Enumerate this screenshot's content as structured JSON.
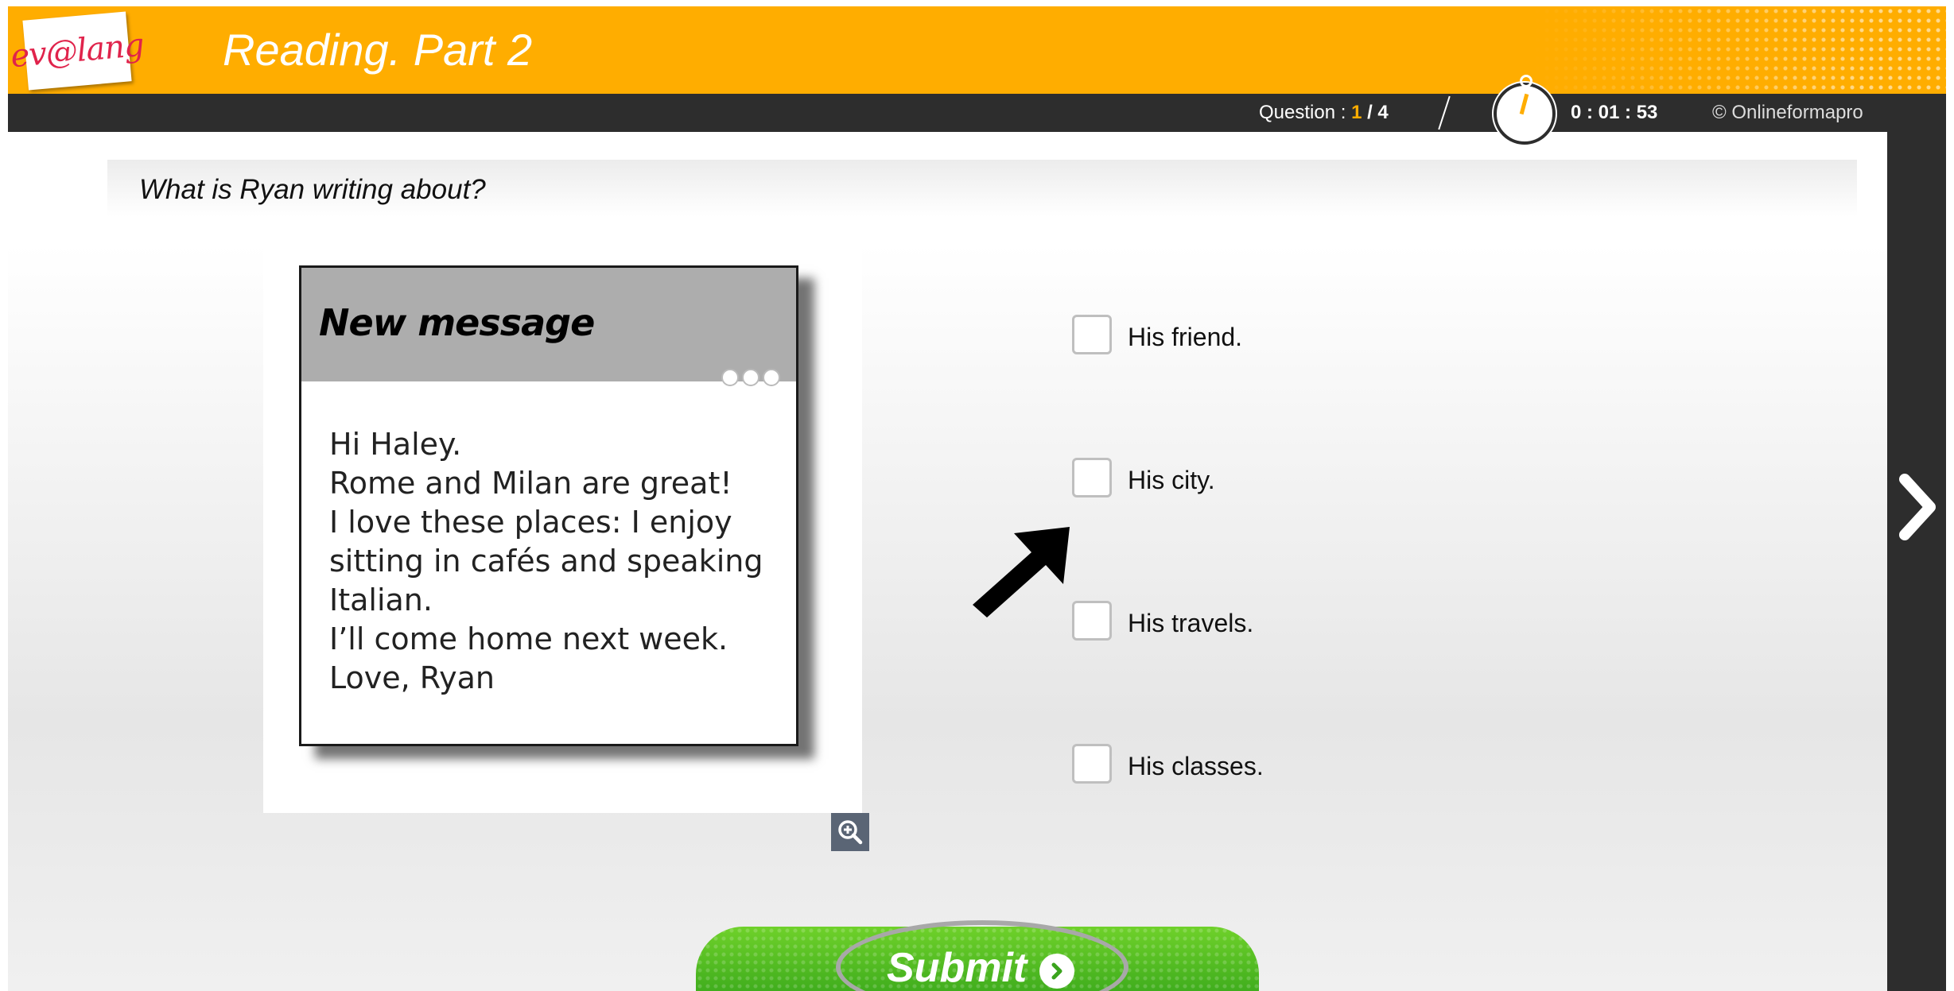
{
  "header": {
    "logo_text": "ev@lang",
    "title": "Reading. Part 2"
  },
  "status": {
    "question_label": "Question : ",
    "question_current": "1",
    "question_total": " / 4",
    "timer": "0 : 01 : 53",
    "copyright": "© Onlineformapro"
  },
  "question": {
    "text": "What is Ryan writing about?"
  },
  "message": {
    "title": "New message",
    "lines": [
      "Hi Haley.",
      "Rome and Milan are great!",
      "I love these places: I enjoy",
      "sitting in cafés and speaking",
      "Italian.",
      "I’ll come home next week.",
      "Love, Ryan"
    ]
  },
  "answers": [
    {
      "label": "His friend.",
      "checked": false
    },
    {
      "label": "His city.",
      "checked": false
    },
    {
      "label": "His travels.",
      "checked": false
    },
    {
      "label": "His classes.",
      "checked": false
    }
  ],
  "submit": {
    "label": "Submit"
  },
  "icons": {
    "timer": "stopwatch-icon",
    "zoom": "zoom-in-icon",
    "next": "chevron-right-icon",
    "pointer": "arrow-pointer-icon",
    "submit": "circle-chevron-right-icon"
  },
  "colors": {
    "header": "#ffad00",
    "statusbar": "#2d2d2d",
    "question_current": "#ffad00",
    "submit": "#4cb81f",
    "logo_text": "#e0234b"
  }
}
